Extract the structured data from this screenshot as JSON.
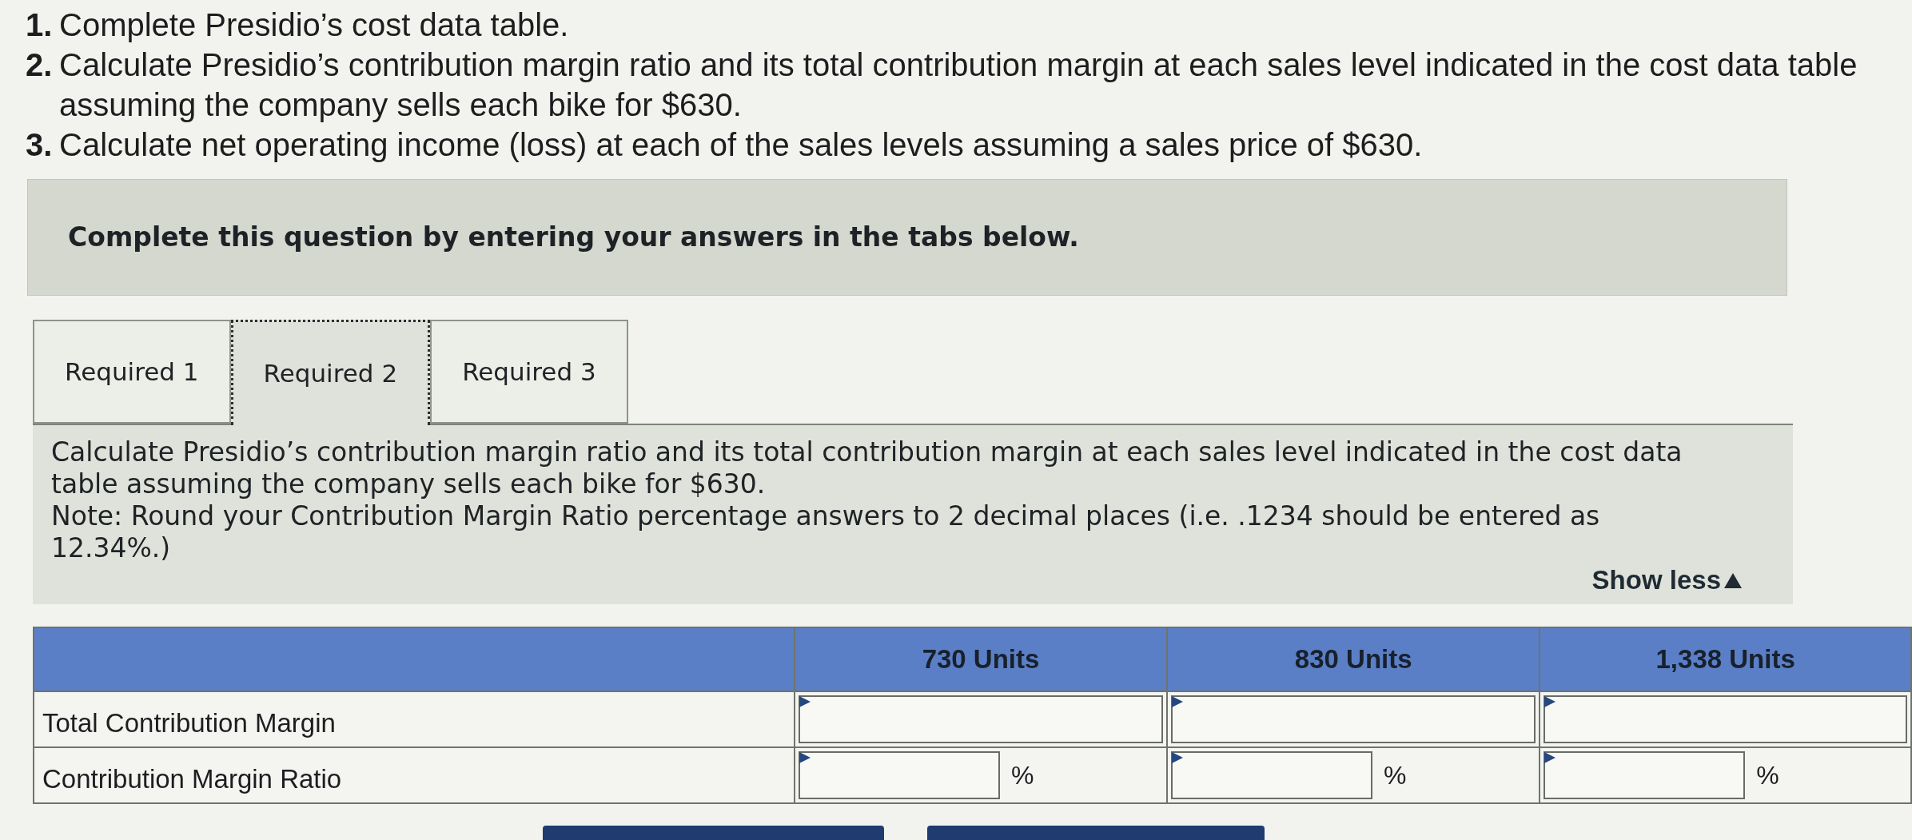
{
  "questions": [
    {
      "number": "1.",
      "text": "Complete Presidio’s cost data table."
    },
    {
      "number": "2.",
      "text": "Calculate Presidio’s contribution margin ratio and its total contribution margin at each sales level indicated in the cost data table assuming the company sells each bike for $630."
    },
    {
      "number": "3.",
      "text": "Calculate net operating income (loss) at each of the sales levels assuming a sales price of $630."
    }
  ],
  "banner": {
    "text": "Complete this question by entering your answers in the tabs below."
  },
  "tabs": [
    {
      "label": "Required 1",
      "selected": false
    },
    {
      "label": "Required 2",
      "selected": true
    },
    {
      "label": "Required 3",
      "selected": false
    }
  ],
  "panel": {
    "instruction": "Calculate Presidio’s contribution margin ratio and its total contribution margin at each sales level indicated in the cost data table assuming the company sells each bike for $630.",
    "note": "Note: Round your Contribution Margin Ratio percentage answers to 2 decimal places (i.e. .1234 should be entered as 12.34%.)",
    "toggle": "Show less"
  },
  "table": {
    "columns": [
      "730 Units",
      "830 Units",
      "1,338 Units"
    ],
    "rows": [
      {
        "label": "Total Contribution Margin",
        "cells": [
          {
            "kind": "amount"
          },
          {
            "kind": "amount"
          },
          {
            "kind": "amount"
          }
        ]
      },
      {
        "label": "Contribution Margin Ratio",
        "cells": [
          {
            "kind": "percent",
            "suffix": "%"
          },
          {
            "kind": "percent",
            "suffix": "%"
          },
          {
            "kind": "percent",
            "suffix": "%"
          }
        ]
      }
    ]
  }
}
